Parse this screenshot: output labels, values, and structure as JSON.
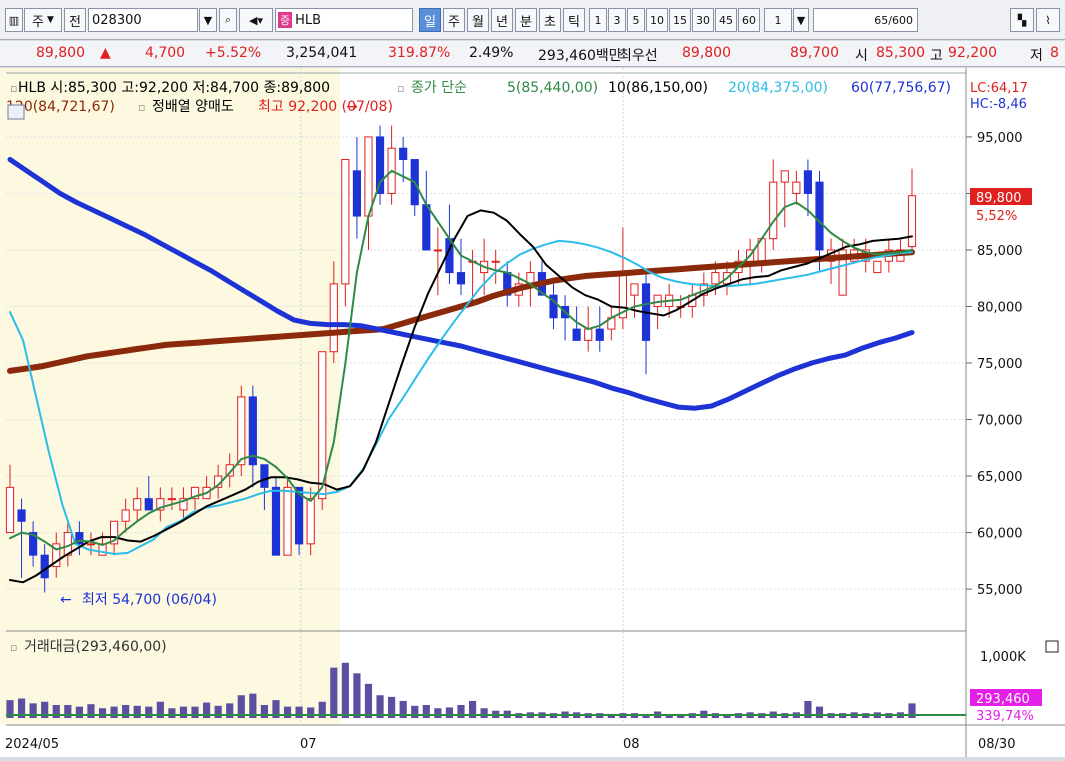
{
  "toolbar": {
    "type_label": "주",
    "jeon_label": "전",
    "stock_code": "028300",
    "stock_tag": "증",
    "stock_name": "HLB",
    "periods": [
      "일",
      "주",
      "월",
      "년",
      "분",
      "초",
      "틱"
    ],
    "active_period": "일",
    "intervals": [
      "1",
      "3",
      "5",
      "10",
      "15",
      "30",
      "45",
      "60"
    ],
    "interval_value": "1",
    "count_value": "65",
    "count_total": "/600"
  },
  "quote": {
    "price": "89,800",
    "up_arrow": "▲",
    "change": "4,700",
    "change_pct": "+5.52%",
    "volume": "3,254,041",
    "volume_ratio": "319.87%",
    "turnover": "2.49%",
    "trade_value": "293,460백만",
    "priority_label": "최우선",
    "ask": "89,800",
    "bid": "89,700",
    "open_label": "시",
    "open": "85,300",
    "high_label": "고",
    "high": "92,200",
    "low_label": "저",
    "low_trunc": "8"
  },
  "chart": {
    "info_line": "HLB 시:85,300 고:92,200 저:84,700 종:89,800",
    "ma_title": "종가 단순",
    "ma_labels": [
      {
        "text": "5(85,440,00)",
        "color": "#2f8a45"
      },
      {
        "text": "10(86,150,00)",
        "color": "#000000"
      },
      {
        "text": "20(84,375,00)",
        "color": "#2cbde8"
      },
      {
        "text": "60(77,756,67)",
        "color": "#1d33d6"
      }
    ],
    "ma120_label": "120(84,721,67)",
    "event_label": "정배열 양매도",
    "high_marker": "최고 92,200 (07/08)",
    "low_marker": "최저 54,700 (06/04)",
    "lc_label": "LC:64,17",
    "hc_label": "HC:-8,46",
    "current_price": "89,800",
    "current_pct": "5,52%",
    "volume_title": "거래대금(293,460,00)",
    "volume_value": "293,460",
    "volume_pct": "339,74%",
    "volume_axis": "1,000K",
    "date_labels": [
      "2024/05",
      "07",
      "08"
    ],
    "last_date": "08/30",
    "colors": {
      "up": "#e01f1f",
      "down": "#1d33d6",
      "ma5": "#2f8a45",
      "ma10": "#000000",
      "ma20": "#2cbde8",
      "ma60": "#1d33d6",
      "ma120": "#8b2a0a"
    }
  },
  "chart_data": {
    "type": "candlestick",
    "y_ticks": [
      "95,000",
      "90,000",
      "85,000",
      "80,000",
      "75,000",
      "70,000",
      "65,000",
      "60,000",
      "55,000"
    ],
    "ylim": [
      52000,
      98000
    ],
    "candles": [
      [
        60000,
        66000,
        61000,
        64000
      ],
      [
        62000,
        63000,
        56000,
        61000
      ],
      [
        60000,
        61000,
        57000,
        58000
      ],
      [
        58000,
        59000,
        54700,
        56000
      ],
      [
        57000,
        60000,
        56000,
        59000
      ],
      [
        58000,
        61000,
        57000,
        60000
      ],
      [
        60000,
        61000,
        58000,
        59000
      ],
      [
        59000,
        60000,
        58000,
        59000
      ],
      [
        58000,
        60000,
        58000,
        59000
      ],
      [
        59000,
        61000,
        58000,
        61000
      ],
      [
        61000,
        63000,
        60000,
        62000
      ],
      [
        62000,
        64000,
        61000,
        63000
      ],
      [
        63000,
        65000,
        62000,
        62000
      ],
      [
        62000,
        64000,
        61000,
        63000
      ],
      [
        63000,
        64000,
        62000,
        63000
      ],
      [
        62000,
        64000,
        61000,
        63000
      ],
      [
        63000,
        64000,
        62000,
        64000
      ],
      [
        63000,
        65000,
        63000,
        64000
      ],
      [
        64000,
        66000,
        63000,
        65000
      ],
      [
        65000,
        67000,
        64000,
        66000
      ],
      [
        66000,
        73000,
        65000,
        72000
      ],
      [
        72000,
        73000,
        64000,
        66000
      ],
      [
        66000,
        66000,
        62000,
        64000
      ],
      [
        64000,
        65000,
        58000,
        58000
      ],
      [
        58000,
        65000,
        58000,
        64000
      ],
      [
        64000,
        64000,
        58000,
        59000
      ],
      [
        59000,
        64000,
        58000,
        63000
      ],
      [
        63000,
        76000,
        62000,
        76000
      ],
      [
        76000,
        84000,
        75000,
        82000
      ],
      [
        82000,
        93000,
        80000,
        93000
      ],
      [
        92000,
        95000,
        86000,
        88000
      ],
      [
        88000,
        92200,
        85000,
        95000
      ],
      [
        95000,
        96000,
        89000,
        90000
      ],
      [
        90000,
        96000,
        89000,
        94000
      ],
      [
        94000,
        95000,
        91000,
        93000
      ],
      [
        93000,
        93000,
        88000,
        89000
      ],
      [
        89000,
        92000,
        85000,
        85000
      ],
      [
        85000,
        87000,
        81000,
        85000
      ],
      [
        86000,
        89000,
        82000,
        83000
      ],
      [
        83000,
        86000,
        81000,
        82000
      ],
      [
        84000,
        85000,
        80000,
        84000
      ],
      [
        83000,
        86000,
        81000,
        84000
      ],
      [
        84000,
        85000,
        82000,
        84000
      ],
      [
        83000,
        84000,
        80000,
        81000
      ],
      [
        81000,
        83000,
        80000,
        82000
      ],
      [
        82000,
        84000,
        80000,
        83000
      ],
      [
        83000,
        84000,
        81000,
        81000
      ],
      [
        81000,
        82000,
        78000,
        79000
      ],
      [
        80000,
        81000,
        77000,
        79000
      ],
      [
        78000,
        80000,
        77000,
        77000
      ],
      [
        77000,
        80000,
        76000,
        78000
      ],
      [
        78000,
        80000,
        76000,
        77000
      ],
      [
        78000,
        80000,
        77000,
        79000
      ],
      [
        79000,
        87000,
        78000,
        83000
      ],
      [
        81000,
        82000,
        79000,
        82000
      ],
      [
        82000,
        83000,
        74000,
        77000
      ],
      [
        80000,
        81000,
        78000,
        81000
      ],
      [
        80000,
        82000,
        79000,
        81000
      ],
      [
        80000,
        81000,
        79000,
        80000
      ],
      [
        80000,
        82000,
        79000,
        81000
      ],
      [
        81000,
        83000,
        80000,
        82000
      ],
      [
        82000,
        84000,
        81000,
        83000
      ],
      [
        82000,
        84000,
        81000,
        83000
      ],
      [
        83000,
        85000,
        82000,
        84000
      ],
      [
        84000,
        86000,
        82000,
        85000
      ],
      [
        84000,
        86000,
        83000,
        86000
      ],
      [
        86000,
        93000,
        85000,
        91000
      ],
      [
        91000,
        92000,
        87000,
        92000
      ],
      [
        90000,
        92000,
        89000,
        91000
      ],
      [
        92000,
        93000,
        88000,
        90000
      ],
      [
        91000,
        92000,
        83000,
        85000
      ],
      [
        84000,
        86000,
        82000,
        85000
      ],
      [
        81000,
        86000,
        81000,
        85000
      ],
      [
        84000,
        86000,
        84000,
        85000
      ],
      [
        84000,
        86000,
        83000,
        85000
      ],
      [
        83000,
        84000,
        83000,
        84000
      ],
      [
        84000,
        86000,
        83000,
        85000
      ],
      [
        84000,
        86000,
        84000,
        85000
      ],
      [
        85300,
        92200,
        84700,
        89800
      ]
    ],
    "ma5": [
      59500,
      60000,
      59800,
      59200,
      58500,
      58800,
      59300,
      59200,
      58900,
      59300,
      60200,
      61000,
      61700,
      62200,
      62500,
      62800,
      63200,
      63500,
      64200,
      65300,
      66500,
      66800,
      66500,
      65800,
      64800,
      63400,
      62800,
      64000,
      68000,
      75000,
      83000,
      88000,
      91000,
      92000,
      91500,
      91000,
      89000,
      87500,
      86000,
      84500,
      84000,
      83500,
      83200,
      83000,
      82500,
      82000,
      81200,
      80500,
      79500,
      78600,
      78000,
      78300,
      79000,
      79500,
      80000,
      80200,
      80400,
      80500,
      80600,
      81000,
      81400,
      81800,
      82500,
      83500,
      84500,
      86000,
      87500,
      88800,
      89200,
      88500,
      87500,
      86500,
      85800,
      85200,
      84800,
      84600,
      84700,
      84800,
      85000
    ],
    "ma10": [
      55800,
      55600,
      56200,
      57000,
      57800,
      58500,
      59200,
      59600,
      59600,
      59300,
      59200,
      59700,
      60300,
      60900,
      61600,
      62300,
      62800,
      63300,
      63800,
      64500,
      64900,
      64900,
      64700,
      64400,
      64300,
      63800,
      64100,
      65500,
      68000,
      71500,
      75000,
      78300,
      81200,
      83600,
      86000,
      88000,
      88500,
      88300,
      87600,
      86400,
      85300,
      83700,
      82700,
      81700,
      81000,
      80600,
      80000,
      79900,
      79600,
      79400,
      79200,
      79700,
      80400,
      81100,
      81600,
      82000,
      82400,
      82600,
      82700,
      83200,
      83500,
      83800,
      84300,
      84800,
      85300,
      85500,
      85800,
      85900,
      86000,
      86200
    ],
    "ma20": [
      79500,
      77000,
      72000,
      67000,
      62500,
      59000,
      58500,
      58300,
      58100,
      58200,
      58800,
      59400,
      60500,
      61000,
      61800,
      62200,
      62400,
      62700,
      63000,
      63400,
      63700,
      63700,
      63600,
      63500,
      63400,
      63600,
      64100,
      65600,
      67800,
      70100,
      71800,
      73600,
      75400,
      77100,
      78700,
      80200,
      81700,
      82900,
      83800,
      84600,
      85100,
      85500,
      85800,
      85700,
      85500,
      85200,
      84800,
      84300,
      83700,
      83000,
      82500,
      82200,
      82000,
      81900,
      81800,
      81800,
      81900,
      82000,
      82200,
      82400,
      82600,
      82800,
      83100,
      83400,
      83700,
      84000,
      84300,
      84500,
      84700,
      84800
    ],
    "ma60": [
      93000,
      92000,
      91000,
      90000,
      89200,
      88500,
      87800,
      87100,
      86400,
      85600,
      84800,
      84000,
      83200,
      82300,
      81400,
      80500,
      79600,
      78800,
      78500,
      78400,
      78400,
      78300,
      78000,
      77700,
      77400,
      77100,
      76800,
      76500,
      76100,
      75700,
      75300,
      74900,
      74500,
      74100,
      73700,
      73300,
      72800,
      72400,
      71900,
      71500,
      71100,
      71000,
      71200,
      71800,
      72500,
      73200,
      73900,
      74500,
      75000,
      75400,
      75700,
      76300,
      76800,
      77200,
      77700
    ],
    "ma120": [
      74300,
      74500,
      74700,
      75000,
      75300,
      75600,
      75800,
      76000,
      76200,
      76400,
      76600,
      76700,
      76800,
      76900,
      77000,
      77100,
      77200,
      77300,
      77400,
      77500,
      77600,
      77700,
      77800,
      77900,
      78000,
      78400,
      78800,
      79200,
      79600,
      80000,
      80400,
      80900,
      81300,
      81700,
      82000,
      82300,
      82500,
      82700,
      82800,
      82900,
      83000,
      83100,
      83200,
      83300,
      83400,
      83500,
      83600,
      83700,
      83800,
      83900,
      84000,
      84100,
      84200,
      84300,
      84400,
      84500,
      84600,
      84700,
      84800
    ],
    "volume_values": [
      22,
      24,
      18,
      20,
      16,
      16,
      14,
      17,
      12,
      14,
      16,
      15,
      14,
      20,
      12,
      14,
      14,
      19,
      15,
      18,
      28,
      30,
      16,
      22,
      14,
      14,
      13,
      20,
      62,
      68,
      55,
      42,
      28,
      26,
      21,
      15,
      16,
      12,
      13,
      16,
      21,
      12,
      9,
      9,
      6,
      7,
      7,
      6,
      8,
      7,
      6,
      6,
      5,
      6,
      6,
      5,
      8,
      5,
      5,
      6,
      9,
      6,
      5,
      6,
      7,
      6,
      8,
      6,
      7,
      21,
      14,
      6,
      6,
      7,
      6,
      7,
      6,
      7,
      18
    ],
    "volume_ylim": [
      0,
      80
    ]
  }
}
